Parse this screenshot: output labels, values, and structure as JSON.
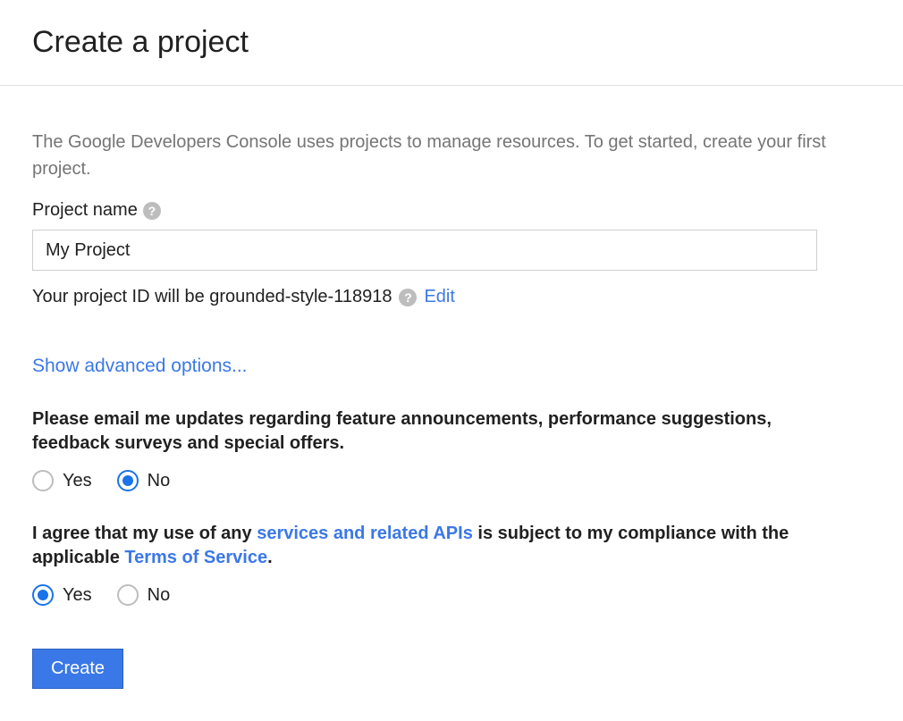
{
  "header": {
    "title": "Create a project"
  },
  "intro_text": "The Google Developers Console uses projects to manage resources. To get started, create your first project.",
  "project_name": {
    "label": "Project name",
    "value": "My Project"
  },
  "project_id": {
    "prefix": "Your project ID will be ",
    "value": "grounded-style-118918",
    "edit_label": "Edit"
  },
  "advanced_link": "Show advanced options...",
  "email_updates": {
    "question": "Please email me updates regarding feature announcements, performance suggestions, feedback surveys and special offers.",
    "yes_label": "Yes",
    "no_label": "No",
    "selected": "No"
  },
  "agree_terms": {
    "prefix": "I agree that my use of any ",
    "link1": "services and related APIs",
    "middle": " is subject to my compliance with the applicable ",
    "link2": "Terms of Service",
    "suffix": ".",
    "yes_label": "Yes",
    "no_label": "No",
    "selected": "Yes"
  },
  "create_button": "Create"
}
